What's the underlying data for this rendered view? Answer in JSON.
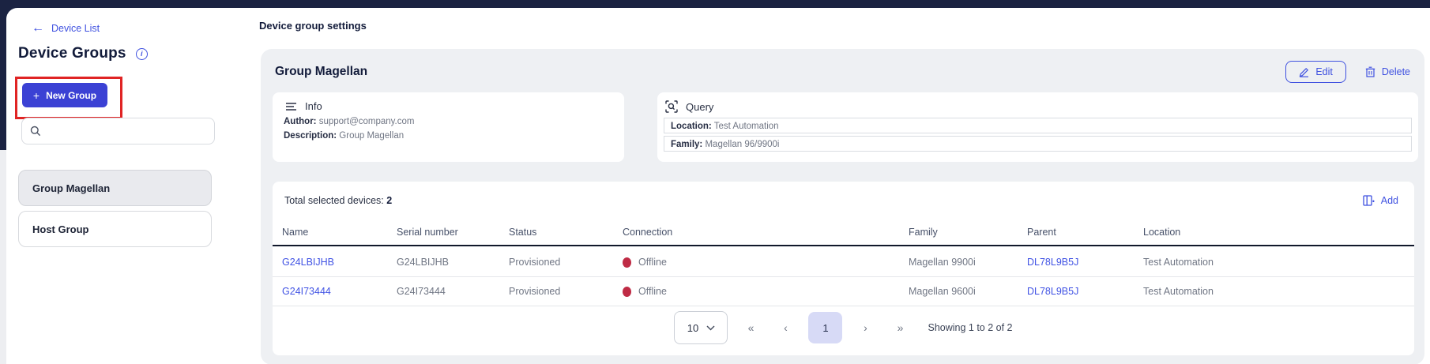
{
  "sidebar": {
    "back_link": "Device List",
    "title": "Device Groups",
    "new_group_button": "New Group",
    "plus_glyph": "+",
    "groups": [
      {
        "label": "Group Magellan"
      },
      {
        "label": "Host Group"
      }
    ],
    "selected_group": "Group Magellan"
  },
  "main": {
    "page_title": "Device group settings",
    "group_header": "Group Magellan",
    "edit_button": "Edit",
    "delete_button": "Delete",
    "info": {
      "title": "Info",
      "author_label": "Author:",
      "author_value": "support@company.com",
      "description_label": "Description:",
      "description_value": "Group Magellan"
    },
    "query": {
      "title": "Query",
      "rows": [
        {
          "label": "Location:",
          "value": "Test Automation"
        },
        {
          "label": "Family:",
          "value": "Magellan 96/9900i"
        }
      ]
    },
    "devices": {
      "total_label": "Total selected devices:",
      "total_count": "2",
      "add_button": "Add",
      "columns": [
        "Name",
        "Serial number",
        "Status",
        "Connection",
        "Family",
        "Parent",
        "Location"
      ],
      "rows": [
        {
          "name": "G24LBIJHB",
          "serial": "G24LBIJHB",
          "status": "Provisioned",
          "connection": "Offline",
          "family": "Magellan 9900i",
          "parent": "DL78L9B5J",
          "location": "Test Automation"
        },
        {
          "name": "G24I73444",
          "serial": "G24I73444",
          "status": "Provisioned",
          "connection": "Offline",
          "family": "Magellan 9600i",
          "parent": "DL78L9B5J",
          "location": "Test Automation"
        }
      ],
      "pagination": {
        "page_size": "10",
        "first_glyph": "«",
        "prev_glyph": "‹",
        "current_page": "1",
        "next_glyph": "›",
        "last_glyph": "»",
        "summary": "Showing 1 to 2 of 2"
      }
    }
  },
  "colors": {
    "accent_indigo": "#3f51e0",
    "button_indigo": "#3b41d4",
    "annotation_red": "#e02424",
    "offline_dot_red": "#bf2b45",
    "topbar_navy": "#1b2342",
    "card_gray": "#eef0f3"
  }
}
